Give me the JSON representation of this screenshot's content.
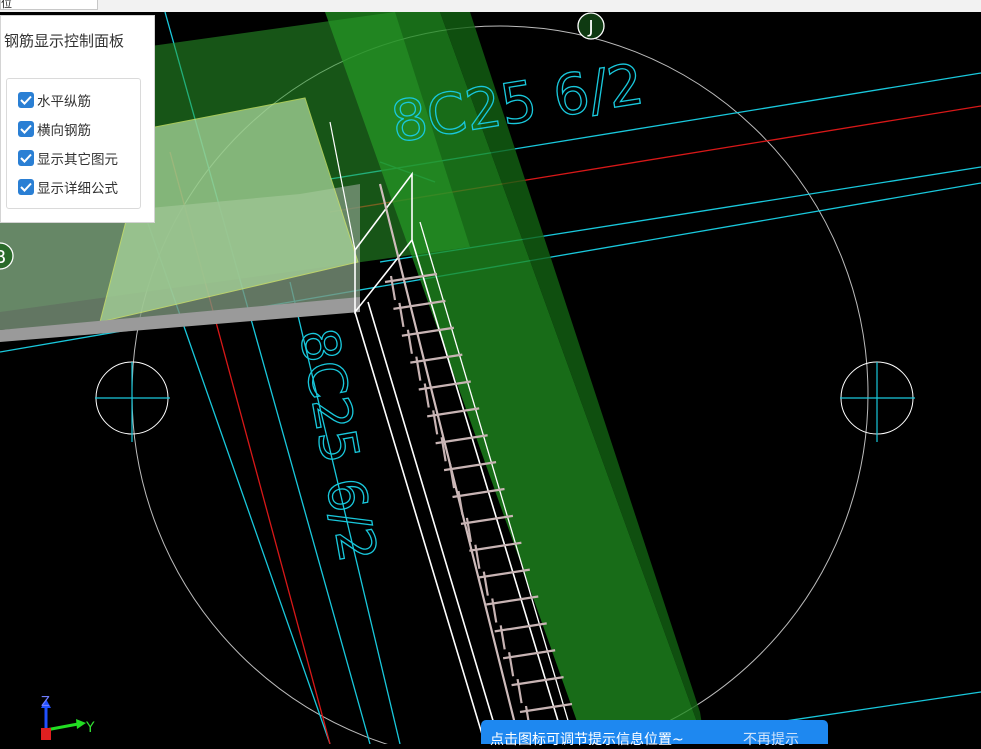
{
  "toolbar": {
    "field_text": "位"
  },
  "panel": {
    "title": "钢筋显示控制面板",
    "options": [
      {
        "label": "水平纵筋",
        "checked": true
      },
      {
        "label": "横向钢筋",
        "checked": true
      },
      {
        "label": "显示其它图元",
        "checked": true
      },
      {
        "label": "显示详细公式",
        "checked": true
      }
    ]
  },
  "grid_labels": {
    "j": "J",
    "b": "B"
  },
  "annotations": {
    "rebar_upper": "8C25 6/2",
    "rebar_lower": "8C25 6/2"
  },
  "axis": {
    "z": "Z",
    "y": "Y"
  },
  "tip": {
    "text": "点击图标可调节提示信息位置~",
    "dismiss": "不再提示"
  },
  "colors": {
    "background": "#000000",
    "beam_green": "#1f8a1f",
    "grid_cyan": "#19c8dc",
    "axis_red": "#d81818",
    "checkbox_blue": "#2a7fd4",
    "tip_blue": "#1e88f0"
  }
}
